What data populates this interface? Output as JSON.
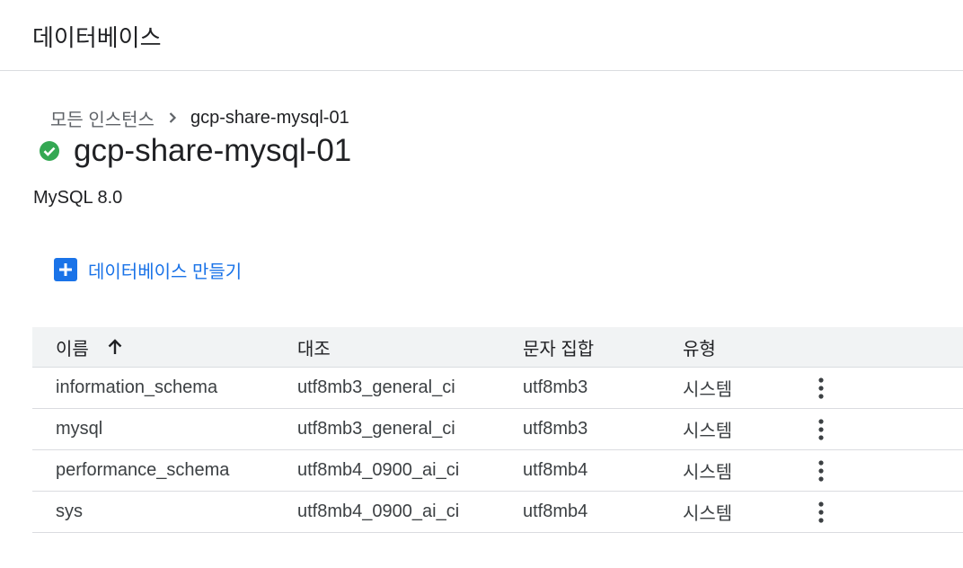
{
  "header": {
    "title": "데이터베이스"
  },
  "breadcrumb": {
    "parent": "모든 인스턴스",
    "separator_icon": "chevron-right-icon",
    "current": "gcp-share-mysql-01"
  },
  "instance": {
    "status_icon": "check-circle-icon",
    "status_color": "#34a853",
    "name": "gcp-share-mysql-01",
    "version": "MySQL 8.0"
  },
  "actions": {
    "create_icon": "plus-box-icon",
    "create_label": "데이터베이스 만들기",
    "accent_color": "#1a73e8"
  },
  "table": {
    "headers": {
      "name": "이름",
      "collation": "대조",
      "charset": "문자 집합",
      "type": "유형"
    },
    "sort": {
      "column": "name",
      "direction": "ascending",
      "icon": "arrow-up-icon"
    },
    "row_menu_icon": "more-vert-icon",
    "rows": [
      {
        "name": "information_schema",
        "collation": "utf8mb3_general_ci",
        "charset": "utf8mb3",
        "type": "시스템"
      },
      {
        "name": "mysql",
        "collation": "utf8mb3_general_ci",
        "charset": "utf8mb3",
        "type": "시스템"
      },
      {
        "name": "performance_schema",
        "collation": "utf8mb4_0900_ai_ci",
        "charset": "utf8mb4",
        "type": "시스템"
      },
      {
        "name": "sys",
        "collation": "utf8mb4_0900_ai_ci",
        "charset": "utf8mb4",
        "type": "시스템"
      }
    ]
  }
}
